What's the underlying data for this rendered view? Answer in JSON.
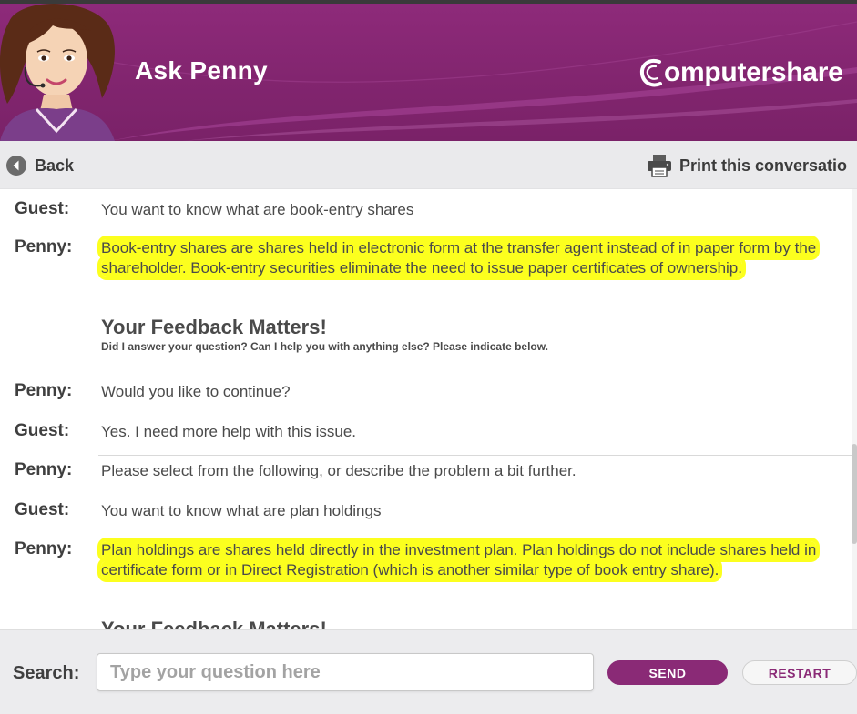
{
  "header": {
    "title": "Ask Penny",
    "brand_text": "omputershare",
    "brand_full": "Computershare",
    "avatar_icon": "penny-avatar-icon"
  },
  "toolbar": {
    "back_label": "Back",
    "print_label": "Print this conversatio"
  },
  "conversation": {
    "messages": [
      {
        "speaker": "Guest:",
        "text": "You want to know what are book-entry shares",
        "highlighted": false
      },
      {
        "speaker": "Penny:",
        "text": "Book-entry shares are shares held in electronic form at the transfer agent instead of in paper form by the shareholder. Book-entry securities eliminate the need to issue paper certificates of ownership.",
        "highlighted": true
      },
      {
        "speaker": "Penny:",
        "text": "Would you like to continue?",
        "highlighted": false
      },
      {
        "speaker": "Guest:",
        "text": "Yes. I need more help with this issue.",
        "highlighted": false
      },
      {
        "speaker": "Penny:",
        "text": "Please select from the following, or describe the problem a bit further.",
        "highlighted": false
      },
      {
        "speaker": "Guest:",
        "text": "You want to know what are plan holdings",
        "highlighted": false
      },
      {
        "speaker": "Penny:",
        "text": "Plan holdings are shares held directly in the investment plan. Plan holdings do not include shares held in certificate form or in Direct Registration (which is another similar type of book entry share).",
        "highlighted": true
      }
    ],
    "feedback": {
      "title": "Your Feedback Matters!",
      "subtitle": "Did I answer your question? Can I help you with anything else? Please indicate below."
    },
    "feedback_repeat_title": "Your Feedback Matters!"
  },
  "footer": {
    "search_label": "Search:",
    "search_placeholder": "Type your question here",
    "send_label": "SEND",
    "restart_label": "RESTART"
  },
  "colors": {
    "header": "#8e2a7a",
    "highlight": "#fcff1e",
    "send_button": "#8a2a76",
    "toolbar": "#eaeaec"
  }
}
